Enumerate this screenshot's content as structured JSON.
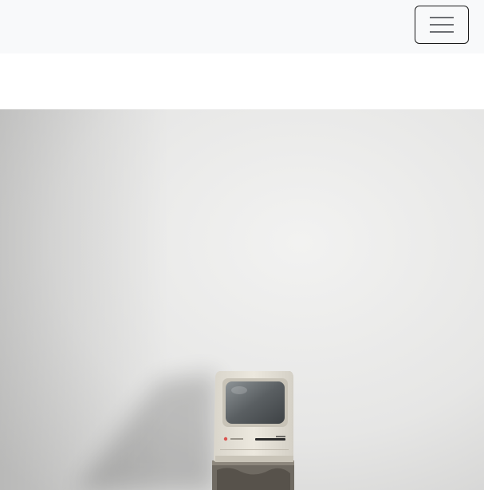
{
  "navbar": {
    "background": "#f8f9fa",
    "toggler_icon": "hamburger-menu-icon"
  },
  "hero": {
    "image_subject": "vintage-computer-photo"
  }
}
